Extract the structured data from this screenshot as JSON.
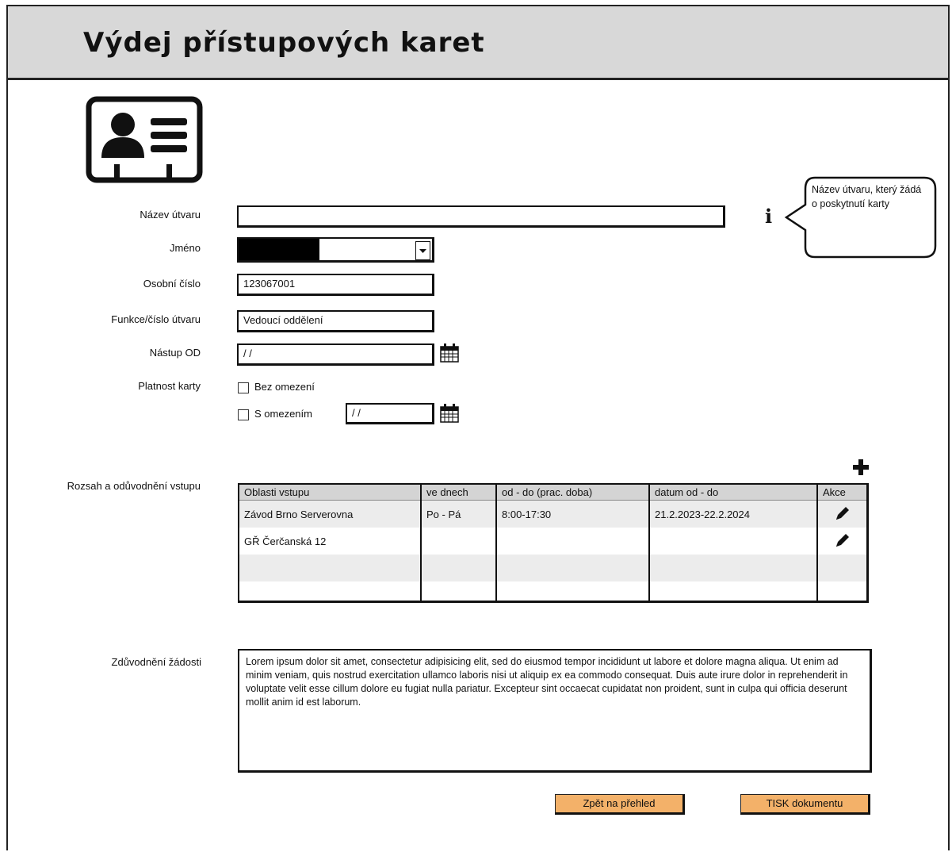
{
  "header": {
    "title": "Výdej přístupových karet"
  },
  "form": {
    "unit_label": "Název útvaru",
    "unit_value": "",
    "name_label": "Jméno",
    "personal_no_label": "Osobní číslo",
    "personal_no_value": "123067001",
    "function_label": "Funkce/číslo útvaru",
    "function_value": "Vedoucí oddělení",
    "start_label": "Nástup OD",
    "start_value": " / /",
    "validity_label": "Platnost karty",
    "no_limit_label": "Bez omezení",
    "limited_label": "S omezením",
    "limited_date_value": " / /"
  },
  "tooltip": {
    "text": "Název útvaru, který žádá o poskytnutí karty"
  },
  "access": {
    "label": "Rozsah a odůvodnění vstupu",
    "columns": [
      "Oblasti vstupu",
      "ve dnech",
      "od - do (prac. doba)",
      "datum od - do",
      "Akce"
    ],
    "rows": [
      [
        "Závod Brno Serverovna",
        "Po - Pá",
        "8:00-17:30",
        "21.2.2023-22.2.2024"
      ],
      [
        "GŘ Čerčanská 12",
        "",
        "",
        ""
      ],
      [
        "",
        "",
        "",
        ""
      ],
      [
        "",
        "",
        "",
        ""
      ]
    ]
  },
  "justification": {
    "label": "Zdůvodnění žádosti",
    "text": "Lorem ipsum dolor sit amet, consectetur adipisicing elit, sed do eiusmod tempor incididunt ut labore et dolore magna aliqua. Ut enim ad minim veniam, quis nostrud exercitation ullamco laboris nisi ut aliquip ex ea commodo consequat. Duis aute irure dolor in reprehenderit in voluptate velit esse cillum dolore eu fugiat nulla pariatur. Excepteur sint occaecat cupidatat non proident, sunt in culpa qui officia deserunt mollit anim id est laborum."
  },
  "buttons": {
    "back": "Zpět na přehled",
    "print": "TISK dokumentu"
  },
  "colors": {
    "header_bg": "#d8d8d8",
    "button_bg": "#f3b169"
  }
}
